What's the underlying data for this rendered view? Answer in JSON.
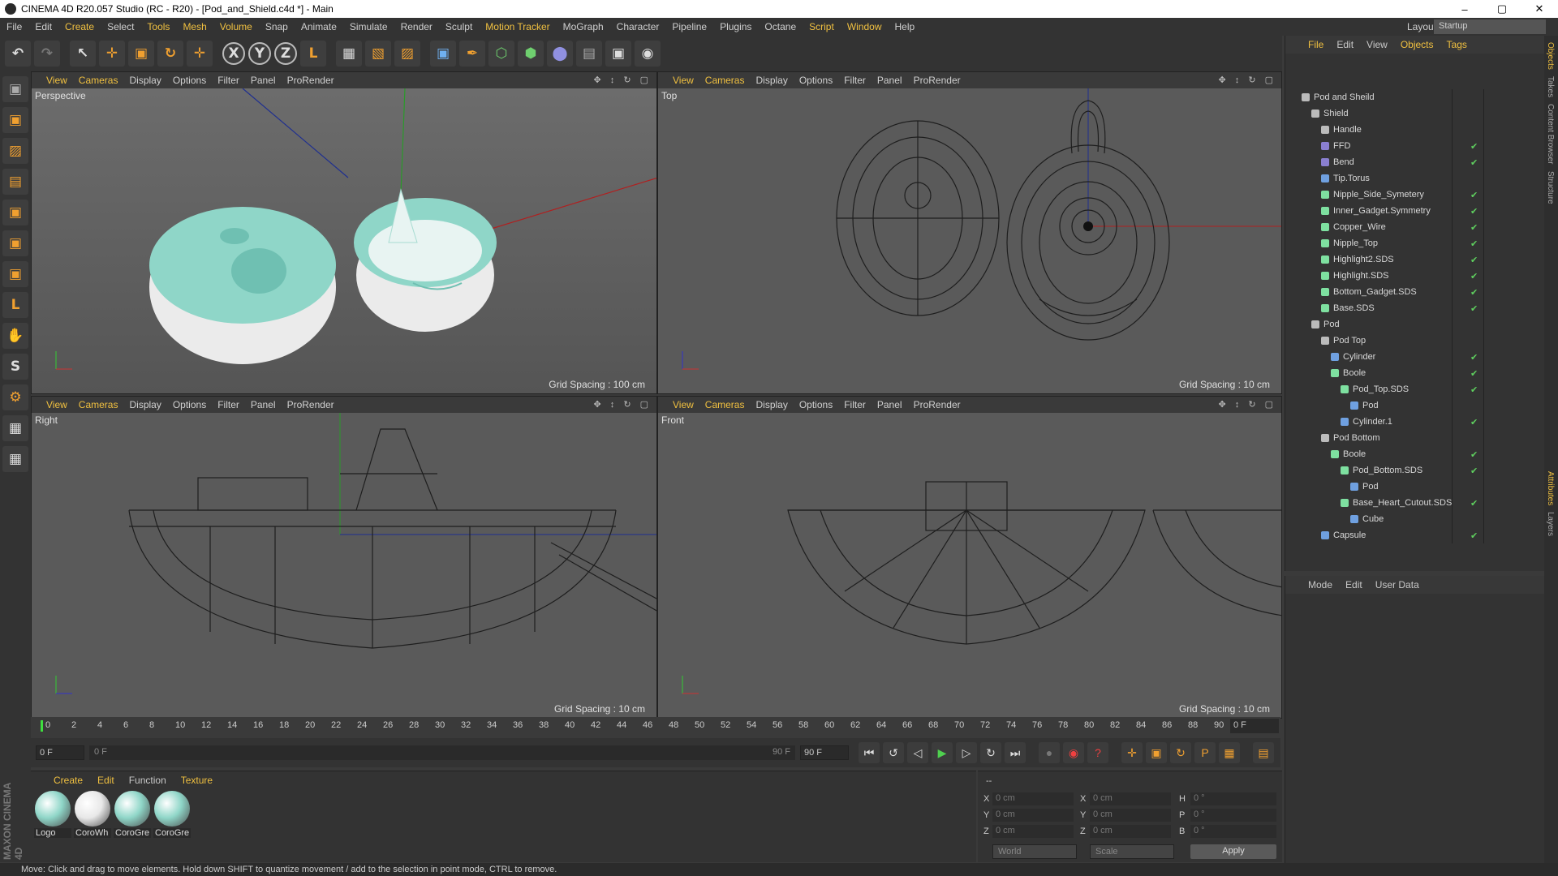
{
  "window": {
    "title": "CINEMA 4D R20.057 Studio (RC - R20) - [Pod_and_Shield.c4d *] - Main",
    "minimize": "–",
    "maximize": "▢",
    "close": "✕"
  },
  "menu": [
    "File",
    "Edit",
    "Create",
    "Select",
    "Tools",
    "Mesh",
    "Volume",
    "Snap",
    "Animate",
    "Simulate",
    "Render",
    "Sculpt",
    "Motion Tracker",
    "MoGraph",
    "Character",
    "Pipeline",
    "Plugins",
    "Octane",
    "Script",
    "Window",
    "Help"
  ],
  "layout": {
    "label": "Layout:",
    "value": "Startup"
  },
  "toolbar": {
    "undo": "↶",
    "redo": "↷",
    "select": "↖",
    "move": "✛",
    "scale": "▣",
    "rotate": "↻",
    "coord": "✛",
    "x": "X",
    "y": "Y",
    "z": "Z",
    "world": "L",
    "render_view": "▦",
    "render_pic": "▧",
    "render_set": "▨",
    "cube": "▣",
    "pen": "✒",
    "subdiv": "⬡",
    "array": "⬢",
    "deformer": "⬤",
    "floor": "▤",
    "camera": "▣",
    "light": "◉"
  },
  "lefttools": {
    "model": "▣",
    "texture": "▨",
    "workplane": "▤",
    "points": "▣",
    "edges": "▣",
    "polys": "▣",
    "axis": "L",
    "tweak": "✋",
    "snap": "S",
    "magnet": "⚙",
    "grid1": "▦",
    "grid2": "▦"
  },
  "viewport_menu": {
    "view": "View",
    "cameras": "Cameras",
    "display": "Display",
    "options": "Options",
    "filter": "Filter",
    "panel": "Panel",
    "prorender": "ProRender",
    "nav": "✥ ↕ ↻ ▢"
  },
  "viewports": [
    {
      "name": "Perspective",
      "grid": "Grid Spacing : 100 cm"
    },
    {
      "name": "Top",
      "grid": "Grid Spacing : 10 cm"
    },
    {
      "name": "Right",
      "grid": "Grid Spacing : 10 cm"
    },
    {
      "name": "Front",
      "grid": "Grid Spacing : 10 cm"
    }
  ],
  "object_manager": {
    "tabs": [
      "File",
      "Edit",
      "View",
      "Objects",
      "Tags"
    ],
    "objects": [
      {
        "name": "Pod and Sheild",
        "depth": 0,
        "color": "#bbbbbb",
        "check": ""
      },
      {
        "name": "Shield",
        "depth": 1,
        "color": "#bbbbbb",
        "check": ""
      },
      {
        "name": "Handle",
        "depth": 2,
        "color": "#bbbbbb",
        "check": ""
      },
      {
        "name": "FFD",
        "depth": 2,
        "color": "#8a7fd0",
        "check": "✔"
      },
      {
        "name": "Bend",
        "depth": 2,
        "color": "#8a7fd0",
        "check": "✔"
      },
      {
        "name": "Tip.Torus",
        "depth": 2,
        "color": "#6fa0e0",
        "check": ""
      },
      {
        "name": "Nipple_Side_Symetery",
        "depth": 2,
        "color": "#7ee0a0",
        "check": "✔"
      },
      {
        "name": "Inner_Gadget.Symmetry",
        "depth": 2,
        "color": "#7ee0a0",
        "check": "✔"
      },
      {
        "name": "Copper_Wire",
        "depth": 2,
        "color": "#7ee0a0",
        "check": "✔"
      },
      {
        "name": "Nipple_Top",
        "depth": 2,
        "color": "#7ee0a0",
        "check": "✔"
      },
      {
        "name": "Highlight2.SDS",
        "depth": 2,
        "color": "#7ee0a0",
        "check": "✔"
      },
      {
        "name": "Highlight.SDS",
        "depth": 2,
        "color": "#7ee0a0",
        "check": "✔"
      },
      {
        "name": "Bottom_Gadget.SDS",
        "depth": 2,
        "color": "#7ee0a0",
        "check": "✔"
      },
      {
        "name": "Base.SDS",
        "depth": 2,
        "color": "#7ee0a0",
        "check": "✔"
      },
      {
        "name": "Pod",
        "depth": 1,
        "color": "#bbbbbb",
        "check": ""
      },
      {
        "name": "Pod Top",
        "depth": 2,
        "color": "#bbbbbb",
        "check": ""
      },
      {
        "name": "Cylinder",
        "depth": 3,
        "color": "#6fa0e0",
        "check": "✔"
      },
      {
        "name": "Boole",
        "depth": 3,
        "color": "#7ee0a0",
        "check": "✔"
      },
      {
        "name": "Pod_Top.SDS",
        "depth": 4,
        "color": "#7ee0a0",
        "check": "✔"
      },
      {
        "name": "Pod",
        "depth": 5,
        "color": "#6fa0e0",
        "check": ""
      },
      {
        "name": "Cylinder.1",
        "depth": 4,
        "color": "#6fa0e0",
        "check": "✔"
      },
      {
        "name": "Pod Bottom",
        "depth": 2,
        "color": "#bbbbbb",
        "check": ""
      },
      {
        "name": "Boole",
        "depth": 3,
        "color": "#7ee0a0",
        "check": "✔"
      },
      {
        "name": "Pod_Bottom.SDS",
        "depth": 4,
        "color": "#7ee0a0",
        "check": "✔"
      },
      {
        "name": "Pod",
        "depth": 5,
        "color": "#6fa0e0",
        "check": ""
      },
      {
        "name": "Base_Heart_Cutout.SDS",
        "depth": 4,
        "color": "#7ee0a0",
        "check": "✔"
      },
      {
        "name": "Cube",
        "depth": 5,
        "color": "#6fa0e0",
        "check": ""
      },
      {
        "name": "Capsule",
        "depth": 2,
        "color": "#6fa0e0",
        "check": "✔"
      }
    ]
  },
  "attributes": {
    "tabs": [
      "Mode",
      "Edit",
      "User Data"
    ]
  },
  "right_tabs": [
    "Objects",
    "Takes",
    "Content Browser",
    "Structure",
    "Attributes",
    "Layers"
  ],
  "timeline": {
    "ticks": [
      "0",
      "2",
      "4",
      "6",
      "8",
      "10",
      "12",
      "14",
      "16",
      "18",
      "20",
      "22",
      "24",
      "26",
      "28",
      "30",
      "32",
      "34",
      "36",
      "38",
      "40",
      "42",
      "44",
      "46",
      "48",
      "50",
      "52",
      "54",
      "56",
      "58",
      "60",
      "62",
      "64",
      "66",
      "68",
      "70",
      "72",
      "74",
      "76",
      "78",
      "80",
      "82",
      "84",
      "86",
      "88",
      "90"
    ],
    "current": "0 F"
  },
  "transport": {
    "start": "0 F",
    "slider_left": "0 F",
    "slider_right": "90 F",
    "end": "90 F",
    "first": "⏮",
    "loop_prev": "↺",
    "prev": "◁",
    "play": "▶",
    "next": "▷",
    "loop": "↻",
    "last": "⏭",
    "keys": "●",
    "autokey": "◉",
    "help": "?",
    "move": "✛",
    "scale": "▣",
    "rot": "↻",
    "p": "P",
    "grid": "▦",
    "tl": "▤"
  },
  "material_manager": {
    "tabs": [
      "Create",
      "Edit",
      "Function",
      "Texture"
    ],
    "materials": [
      {
        "name": "Logo",
        "color": "#8fd6c8"
      },
      {
        "name": "CoroWh",
        "color": "#e8e8e8"
      },
      {
        "name": "CoroGre",
        "color": "#8fd6c8"
      },
      {
        "name": "CoroGre",
        "color": "#8fd6c8"
      }
    ]
  },
  "coordinates": {
    "header": "--",
    "rows": [
      {
        "a": "X",
        "av": "0 cm",
        "b": "X",
        "bv": "0 cm",
        "c": "H",
        "cv": "0 °"
      },
      {
        "a": "Y",
        "av": "0 cm",
        "b": "Y",
        "bv": "0 cm",
        "c": "P",
        "cv": "0 °"
      },
      {
        "a": "Z",
        "av": "0 cm",
        "b": "Z",
        "bv": "0 cm",
        "c": "B",
        "cv": "0 °"
      }
    ],
    "mode1": "World",
    "mode2": "Scale",
    "apply": "Apply"
  },
  "status": "Move: Click and drag to move elements. Hold down SHIFT to quantize movement / add to the selection in point mode, CTRL to remove.",
  "brand": "MAXON CINEMA 4D",
  "colors": {
    "accent": "#f0c040",
    "teal": "#8fd6c8"
  }
}
